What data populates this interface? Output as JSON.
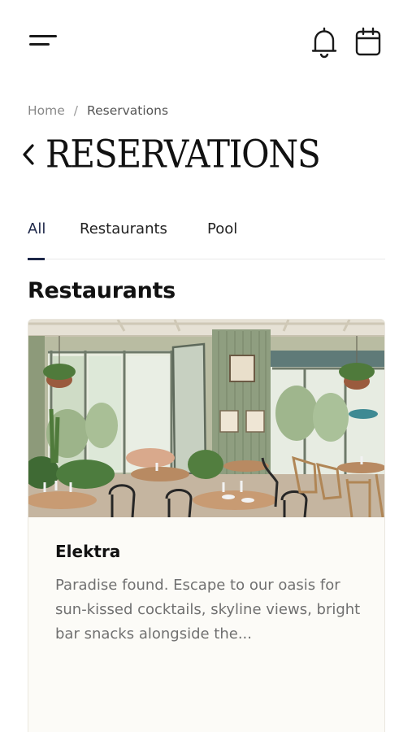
{
  "header": {
    "menu_icon": "hamburger-menu-icon",
    "notifications_icon": "bell-icon",
    "calendar_icon": "calendar-icon"
  },
  "breadcrumb": {
    "home": "Home",
    "separator": "/",
    "current": "Reservations"
  },
  "page": {
    "back_icon": "chevron-left-icon",
    "title": "RESERVATIONS"
  },
  "tabs": [
    {
      "label": "All",
      "active": true
    },
    {
      "label": "Restaurants",
      "active": false
    },
    {
      "label": "Pool",
      "active": false
    }
  ],
  "section": {
    "title": "Restaurants"
  },
  "cards": [
    {
      "name": "Elektra",
      "description": "Paradise found. Escape to our oasis for sun-kissed cocktails, skyline views, bright bar snacks alongside the...",
      "image": "restaurant-interior-photo"
    }
  ],
  "colors": {
    "accent": "#1d2748",
    "card_background": "#fcfbf7",
    "text_muted": "#707070"
  }
}
